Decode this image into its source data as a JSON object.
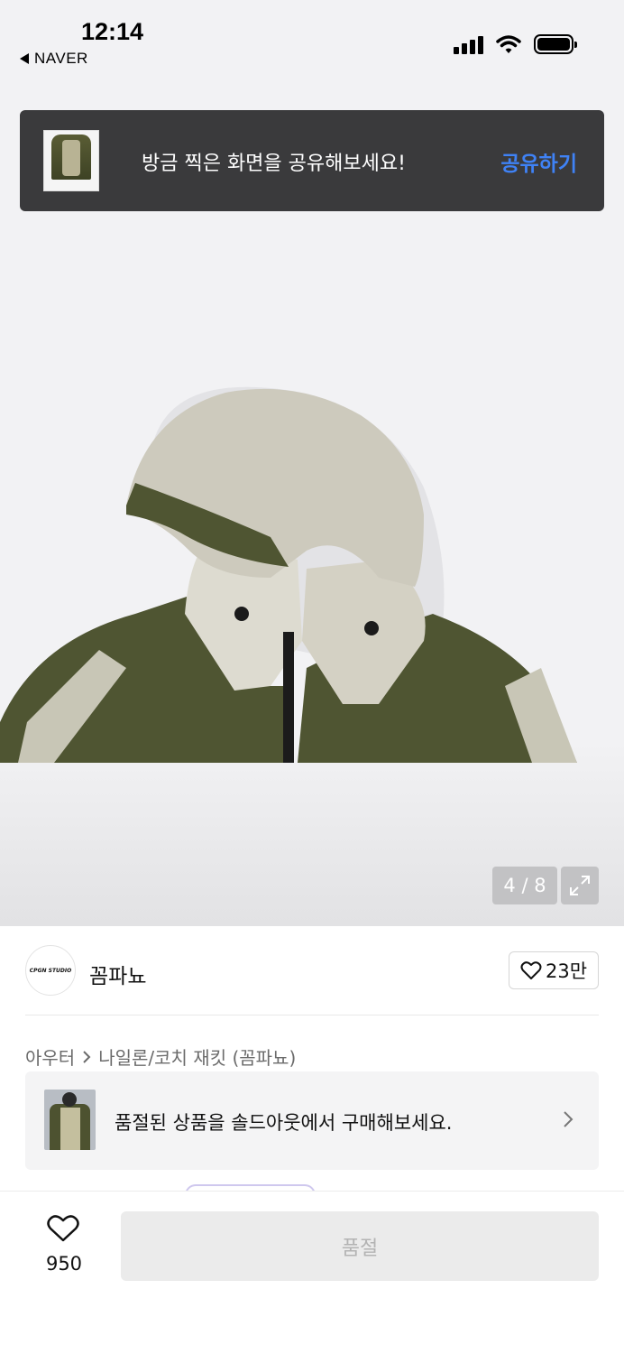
{
  "status_bar": {
    "time": "12:14",
    "back_app": "NAVER"
  },
  "toast": {
    "message": "방금 찍은 화면을 공유해보세요!",
    "action": "공유하기"
  },
  "gallery": {
    "counter": "4 / 8",
    "current_index": 4,
    "total": 8
  },
  "seller": {
    "logo_text": "CPGN STUDIO",
    "name": "꼼파뇨",
    "likes": "23만"
  },
  "breadcrumb": {
    "category": "아우터",
    "subcategory": "나일론/코치 재킷 (꼼파뇨)"
  },
  "soldout_banner": {
    "text": "품절된 상품을 솔드아웃에서 구매해보세요."
  },
  "bottom_bar": {
    "wish_count": "950",
    "buy_label": "품절"
  },
  "colors": {
    "accent_blue": "#3f82f6",
    "toast_bg": "#3a3a3c",
    "jacket_olive": "#4d5230",
    "jacket_beige": "#c9c6b6"
  }
}
